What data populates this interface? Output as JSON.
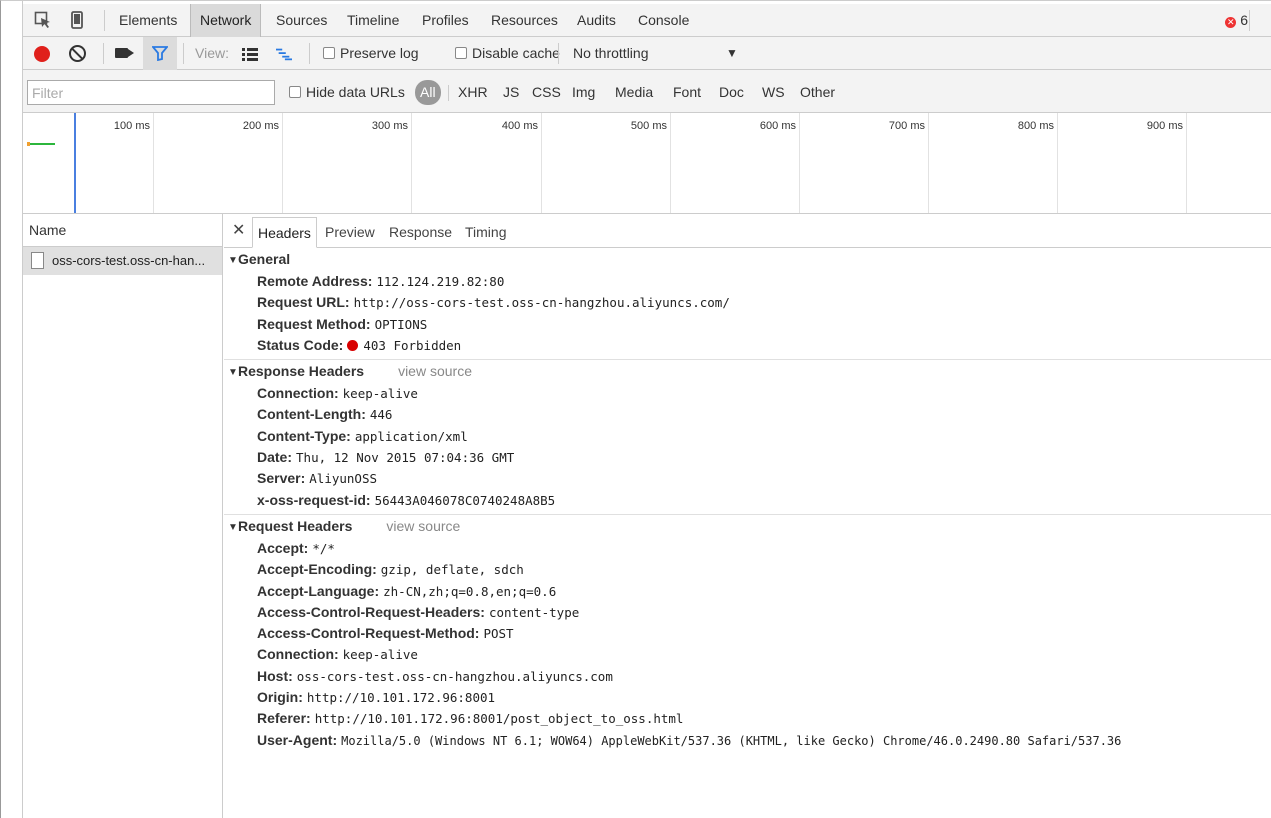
{
  "main_tabs": [
    "Elements",
    "Network",
    "Sources",
    "Timeline",
    "Profiles",
    "Resources",
    "Audits",
    "Console"
  ],
  "active_tab": "Network",
  "error_count": "6",
  "toolbar": {
    "view_label": "View:",
    "preserve_log": "Preserve log",
    "disable_cache": "Disable cache",
    "throttling": "No throttling"
  },
  "filter": {
    "placeholder": "Filter",
    "hide_data_urls": "Hide data URLs",
    "types": [
      "All",
      "XHR",
      "JS",
      "CSS",
      "Img",
      "Media",
      "Font",
      "Doc",
      "WS",
      "Other"
    ]
  },
  "timeline": {
    "ticks": [
      "100 ms",
      "200 ms",
      "300 ms",
      "400 ms",
      "500 ms",
      "600 ms",
      "700 ms",
      "800 ms",
      "900 ms"
    ]
  },
  "name_pane": {
    "header": "Name",
    "requests": [
      "oss-cors-test.oss-cn-han..."
    ]
  },
  "detail_tabs": [
    "Headers",
    "Preview",
    "Response",
    "Timing"
  ],
  "sections": {
    "general": {
      "title": "General",
      "rows": [
        {
          "k": "Remote Address:",
          "v": "112.124.219.82:80"
        },
        {
          "k": "Request URL:",
          "v": "http://oss-cors-test.oss-cn-hangzhou.aliyuncs.com/"
        },
        {
          "k": "Request Method:",
          "v": "OPTIONS"
        },
        {
          "k": "Status Code:",
          "v": "403 Forbidden"
        }
      ]
    },
    "response": {
      "title": "Response Headers",
      "view_source": "view source",
      "rows": [
        {
          "k": "Connection:",
          "v": "keep-alive"
        },
        {
          "k": "Content-Length:",
          "v": "446"
        },
        {
          "k": "Content-Type:",
          "v": "application/xml"
        },
        {
          "k": "Date:",
          "v": "Thu, 12 Nov 2015 07:04:36 GMT"
        },
        {
          "k": "Server:",
          "v": "AliyunOSS"
        },
        {
          "k": "x-oss-request-id:",
          "v": "56443A046078C0740248A8B5"
        }
      ]
    },
    "request": {
      "title": "Request Headers",
      "view_source": "view source",
      "rows": [
        {
          "k": "Accept:",
          "v": "*/*"
        },
        {
          "k": "Accept-Encoding:",
          "v": "gzip, deflate, sdch"
        },
        {
          "k": "Accept-Language:",
          "v": "zh-CN,zh;q=0.8,en;q=0.6"
        },
        {
          "k": "Access-Control-Request-Headers:",
          "v": "content-type"
        },
        {
          "k": "Access-Control-Request-Method:",
          "v": "POST"
        },
        {
          "k": "Connection:",
          "v": "keep-alive"
        },
        {
          "k": "Host:",
          "v": "oss-cors-test.oss-cn-hangzhou.aliyuncs.com"
        },
        {
          "k": "Origin:",
          "v": "http://10.101.172.96:8001"
        },
        {
          "k": "Referer:",
          "v": "http://10.101.172.96:8001/post_object_to_oss.html"
        },
        {
          "k": "User-Agent:",
          "v": "Mozilla/5.0 (Windows NT 6.1; WOW64) AppleWebKit/537.36 (KHTML, like Gecko) Chrome/46.0.2490.80 Safari/537.36"
        }
      ]
    }
  },
  "colors": {
    "record": "#e0201b",
    "status_error": "#d80000",
    "timeline_blue": "#4a7fe0",
    "timeline_green": "#2cb63c"
  }
}
